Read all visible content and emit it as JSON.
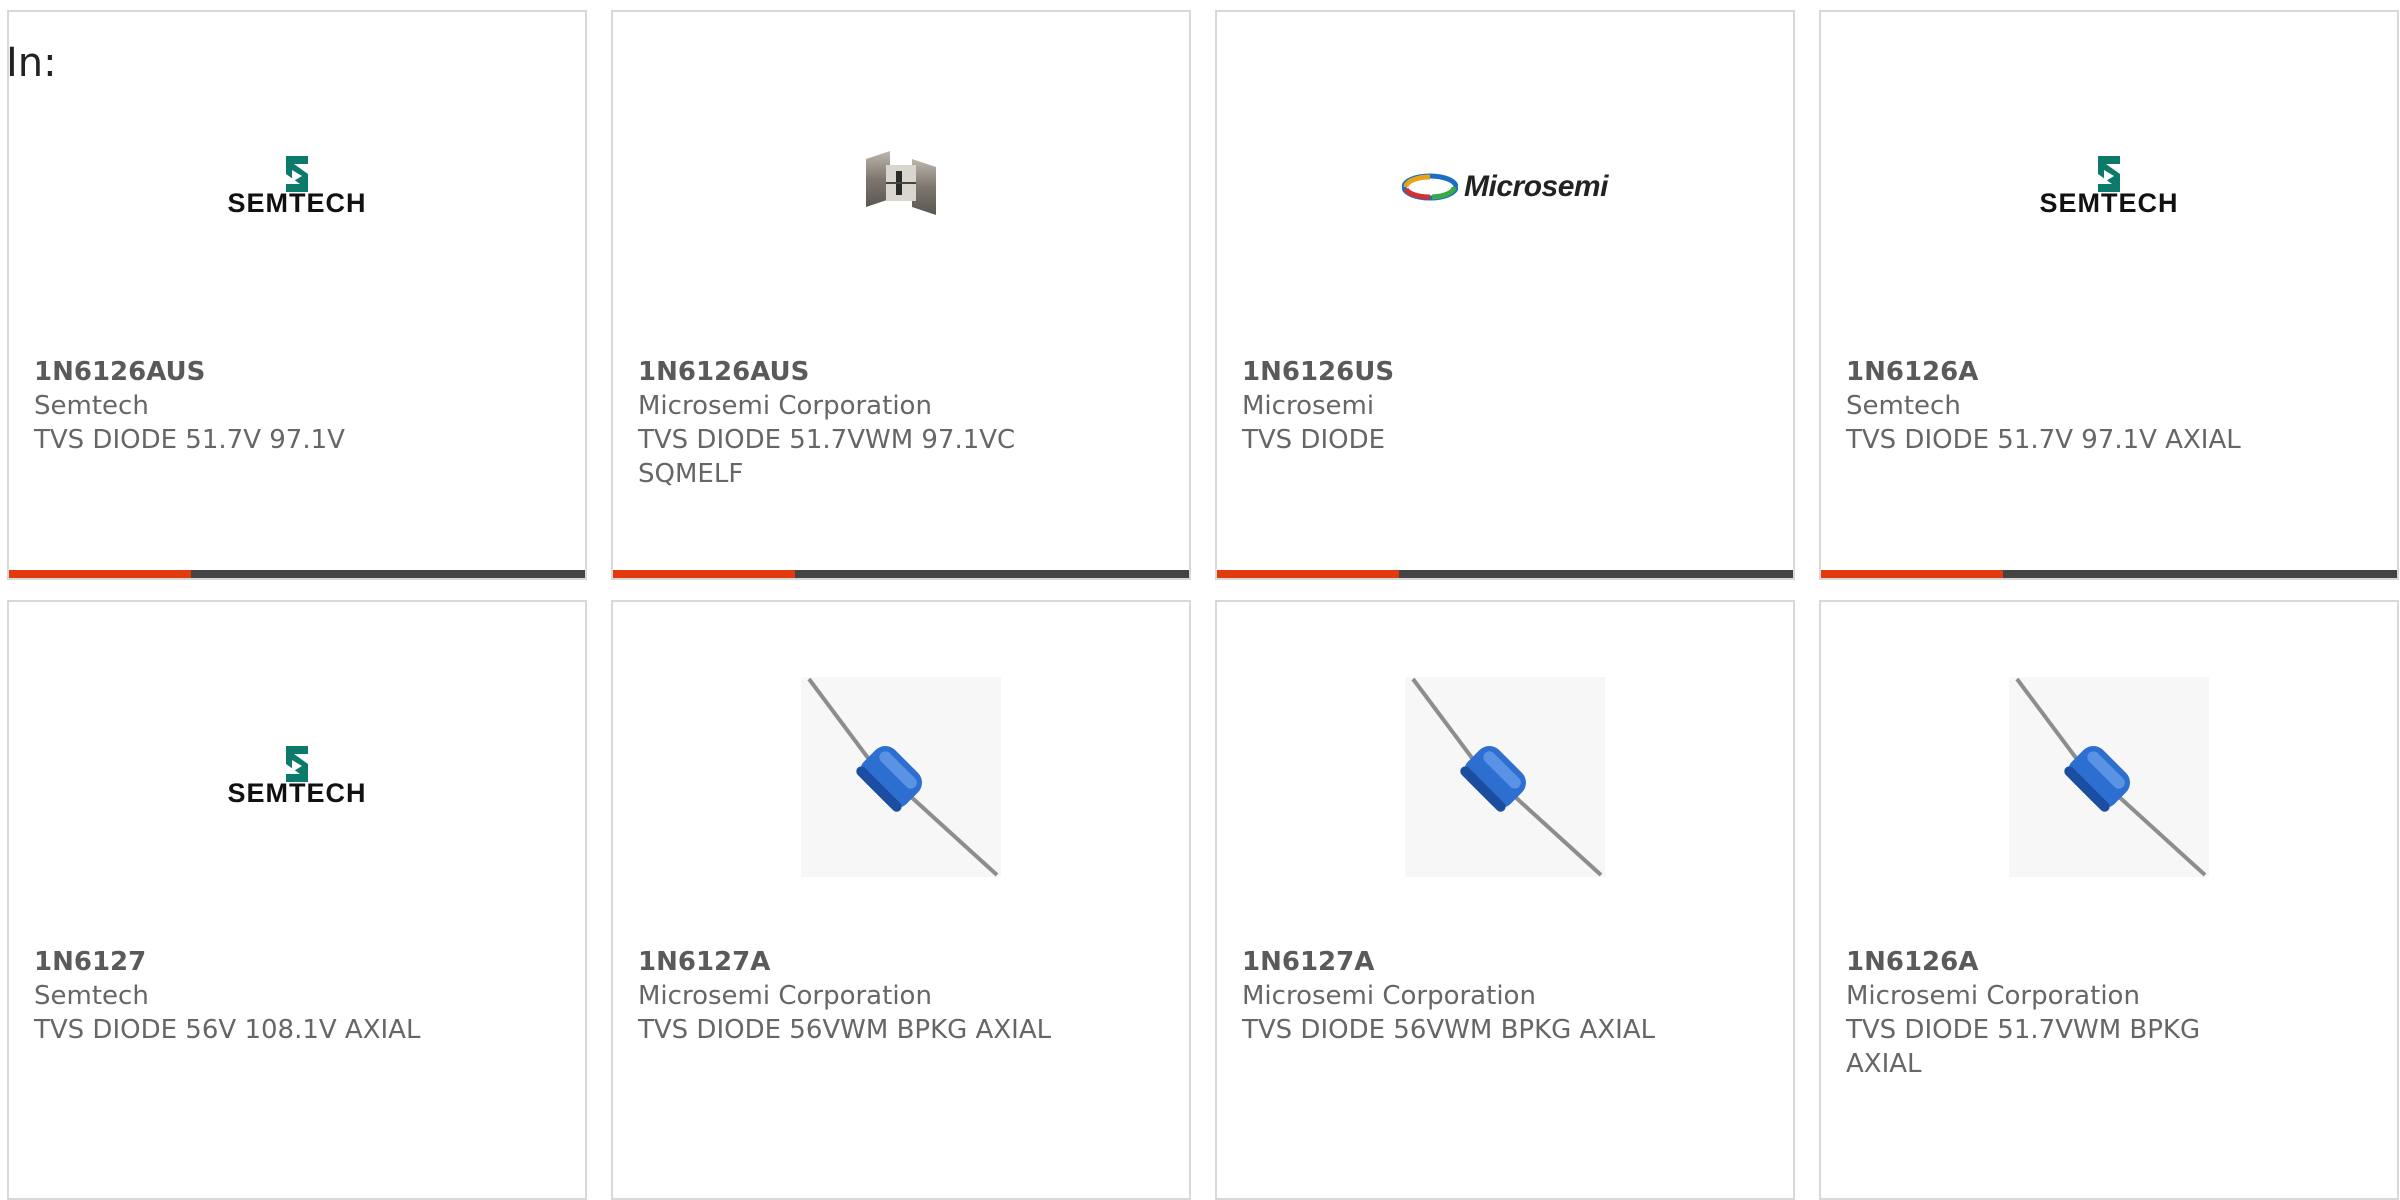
{
  "header": {
    "label": "In:"
  },
  "products": [
    {
      "part": "1N6126AUS",
      "maker": "Semtech",
      "desc": "TVS DIODE 51.7V 97.1V",
      "image": "semtech-logo",
      "show_bar": true
    },
    {
      "part": "1N6126AUS",
      "maker": "Microsemi Corporation",
      "desc": "TVS DIODE 51.7VWM 97.1VC SQMELF",
      "image": "sqmelf-package-photo",
      "show_bar": true
    },
    {
      "part": "1N6126US",
      "maker": "Microsemi",
      "desc": "TVS DIODE",
      "image": "microsemi-logo",
      "show_bar": true
    },
    {
      "part": "1N6126A",
      "maker": "Semtech",
      "desc": "TVS DIODE 51.7V 97.1V AXIAL",
      "image": "semtech-logo",
      "show_bar": true
    },
    {
      "part": "1N6127",
      "maker": "Semtech",
      "desc": "TVS DIODE 56V 108.1V AXIAL",
      "image": "semtech-logo",
      "show_bar": false
    },
    {
      "part": "1N6127A",
      "maker": "Microsemi Corporation",
      "desc": "TVS DIODE 56VWM BPKG AXIAL",
      "image": "axial-diode-photo",
      "show_bar": false
    },
    {
      "part": "1N6127A",
      "maker": "Microsemi Corporation",
      "desc": "TVS DIODE 56VWM BPKG AXIAL",
      "image": "axial-diode-photo",
      "show_bar": false
    },
    {
      "part": "1N6126A",
      "maker": "Microsemi Corporation",
      "desc": "TVS DIODE 51.7VWM BPKG AXIAL",
      "image": "axial-diode-photo",
      "show_bar": false
    }
  ],
  "logos": {
    "semtech_word": "SEMTECH",
    "microsemi_word": "Microsemi"
  },
  "colors": {
    "accent": "#e03a0e",
    "bar": "#444444",
    "card_border": "#d8d8d8",
    "text": "#666666"
  }
}
